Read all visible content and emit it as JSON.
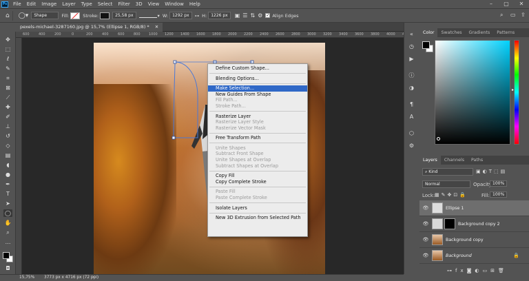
{
  "app": {
    "logo": "Ps"
  },
  "menubar": {
    "items": [
      "File",
      "Edit",
      "Image",
      "Layer",
      "Type",
      "Select",
      "Filter",
      "3D",
      "View",
      "Window",
      "Help"
    ]
  },
  "window_controls": [
    "–",
    "▢",
    "✕"
  ],
  "options_bar": {
    "tool_mode": "Shape",
    "fill_label": "Fill:",
    "stroke_label": "Stroke:",
    "stroke_width": "25,58 px",
    "w_label": "W:",
    "w_value": "1292 px",
    "h_label": "H:",
    "h_value": "1226 px",
    "align_edges": "Align Edges"
  },
  "document": {
    "tab_title": "pexels-michael-3287160.jpg @ 15,7% (Ellipse 1, RGB/8) *"
  },
  "ruler": {
    "ticks": [
      "600",
      "400",
      "200",
      "0",
      "200",
      "400",
      "600",
      "800",
      "1000",
      "1200",
      "1400",
      "1600",
      "1800",
      "2000",
      "2200",
      "2400",
      "2600",
      "2800",
      "3000",
      "3200",
      "3400",
      "3600",
      "3800",
      "4000",
      "4200"
    ]
  },
  "context_menu": {
    "groups": [
      [
        {
          "label": "Define Custom Shape...",
          "state": "enabled"
        }
      ],
      [
        {
          "label": "Blending Options...",
          "state": "enabled"
        }
      ],
      [
        {
          "label": "Make Selection...",
          "state": "highlighted"
        },
        {
          "label": "New Guides From Shape",
          "state": "enabled"
        },
        {
          "label": "Fill Path...",
          "state": "disabled"
        },
        {
          "label": "Stroke Path...",
          "state": "disabled"
        }
      ],
      [
        {
          "label": "Rasterize Layer",
          "state": "enabled"
        },
        {
          "label": "Rasterize Layer Style",
          "state": "disabled"
        },
        {
          "label": "Rasterize Vector Mask",
          "state": "disabled"
        }
      ],
      [
        {
          "label": "Free Transform Path",
          "state": "enabled"
        }
      ],
      [
        {
          "label": "Unite Shapes",
          "state": "disabled"
        },
        {
          "label": "Subtract Front Shape",
          "state": "disabled"
        },
        {
          "label": "Unite Shapes at Overlap",
          "state": "disabled"
        },
        {
          "label": "Subtract Shapes at Overlap",
          "state": "disabled"
        }
      ],
      [
        {
          "label": "Copy Fill",
          "state": "enabled"
        },
        {
          "label": "Copy Complete Stroke",
          "state": "enabled"
        }
      ],
      [
        {
          "label": "Paste Fill",
          "state": "disabled"
        },
        {
          "label": "Paste Complete Stroke",
          "state": "disabled"
        }
      ],
      [
        {
          "label": "Isolate Layers",
          "state": "enabled"
        }
      ],
      [
        {
          "label": "New 3D Extrusion from Selected Path",
          "state": "enabled"
        }
      ]
    ]
  },
  "color_panel": {
    "tabs": [
      "Color",
      "Swatches",
      "Gradients",
      "Patterns"
    ],
    "active_tab": "Color"
  },
  "layers_panel": {
    "tabs": [
      "Layers",
      "Channels",
      "Paths"
    ],
    "kind_label": "Kind",
    "blend_mode": "Normal",
    "opacity_label": "Opacity:",
    "opacity_value": "100%",
    "lock_label": "Lock:",
    "fill_label": "Fill:",
    "fill_value": "100%",
    "layers": [
      {
        "name": "Ellipse 1",
        "selected": true,
        "italic": false
      },
      {
        "name": "Background copy 2",
        "selected": false,
        "italic": false
      },
      {
        "name": "Background copy",
        "selected": false,
        "italic": false
      },
      {
        "name": "Background",
        "selected": false,
        "italic": true
      }
    ]
  },
  "status_bar": {
    "zoom": "15,75%",
    "doc_info": "3773 px x 4716 px (72 ppi)"
  },
  "colors": {
    "highlight": "#2f68c7",
    "ui_bg": "#535353",
    "canvas_bg": "#282828"
  }
}
